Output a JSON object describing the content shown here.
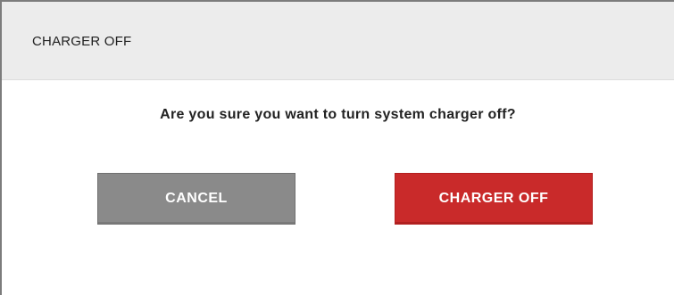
{
  "dialog": {
    "title": "CHARGER OFF",
    "message": "Are you sure you want to turn system charger off?",
    "buttons": {
      "cancel_label": "CANCEL",
      "confirm_label": "CHARGER OFF"
    }
  },
  "colors": {
    "header_bg": "#ececec",
    "cancel_bg": "#8a8a8a",
    "confirm_bg": "#c92a2a",
    "text": "#222222"
  }
}
